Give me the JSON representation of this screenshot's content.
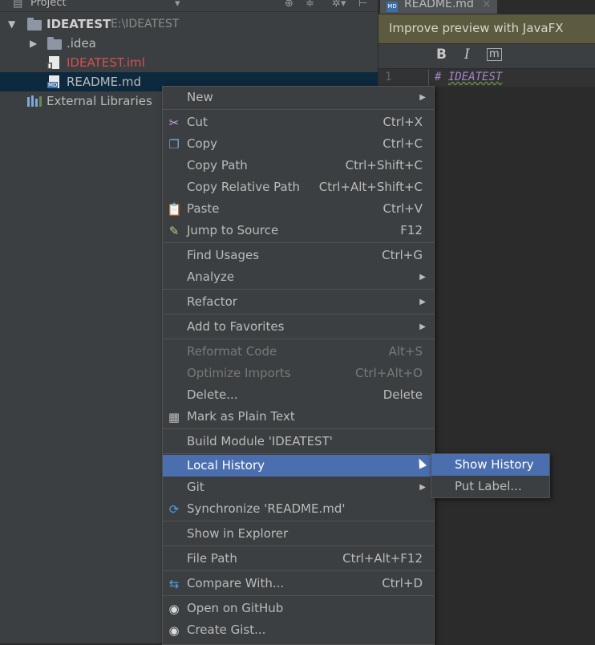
{
  "project_header": {
    "title": "Project"
  },
  "tree": {
    "root": {
      "name": "IDEATEST",
      "path": "E:\\IDEATEST"
    },
    "items": [
      {
        "label": ".idea"
      },
      {
        "label": "IDEATEST.iml"
      },
      {
        "label": "README.md"
      },
      {
        "label": "External Libraries"
      }
    ]
  },
  "editor": {
    "tab_label": "README.md",
    "tab_icon_label": "MD",
    "preview_notice": "Improve preview with JavaFX",
    "toolbar": {
      "bold": "B",
      "italic": "I",
      "mono": "m"
    },
    "line_number": "1",
    "code_hash": "#",
    "code_text": "IDEATEST"
  },
  "context_menu": {
    "items": [
      {
        "label": "New",
        "shortcut": ""
      },
      {
        "label": "Cut",
        "shortcut": "Ctrl+X"
      },
      {
        "label": "Copy",
        "shortcut": "Ctrl+C"
      },
      {
        "label": "Copy Path",
        "shortcut": "Ctrl+Shift+C"
      },
      {
        "label": "Copy Relative Path",
        "shortcut": "Ctrl+Alt+Shift+C"
      },
      {
        "label": "Paste",
        "shortcut": "Ctrl+V"
      },
      {
        "label": "Jump to Source",
        "shortcut": "F12"
      },
      {
        "label": "Find Usages",
        "shortcut": "Ctrl+G"
      },
      {
        "label": "Analyze",
        "shortcut": ""
      },
      {
        "label": "Refactor",
        "shortcut": ""
      },
      {
        "label": "Add to Favorites",
        "shortcut": ""
      },
      {
        "label": "Reformat Code",
        "shortcut": "Alt+S"
      },
      {
        "label": "Optimize Imports",
        "shortcut": "Ctrl+Alt+O"
      },
      {
        "label": "Delete...",
        "shortcut": "Delete"
      },
      {
        "label": "Mark as Plain Text",
        "shortcut": ""
      },
      {
        "label": "Build Module 'IDEATEST'",
        "shortcut": ""
      },
      {
        "label": "Local History",
        "shortcut": ""
      },
      {
        "label": "Git",
        "shortcut": ""
      },
      {
        "label": "Synchronize 'README.md'",
        "shortcut": ""
      },
      {
        "label": "Show in Explorer",
        "shortcut": ""
      },
      {
        "label": "File Path",
        "shortcut": "Ctrl+Alt+F12"
      },
      {
        "label": "Compare With...",
        "shortcut": "Ctrl+D"
      },
      {
        "label": "Open on GitHub",
        "shortcut": ""
      },
      {
        "label": "Create Gist...",
        "shortcut": ""
      }
    ]
  },
  "submenu": {
    "items": [
      {
        "label": "Show History"
      },
      {
        "label": "Put Label..."
      }
    ]
  },
  "colors": {
    "menu_highlight": "#4b6eaf",
    "menu_bg": "#3c3f41",
    "iml_file_text": "#d25252",
    "selected_row": "#0d293e"
  }
}
